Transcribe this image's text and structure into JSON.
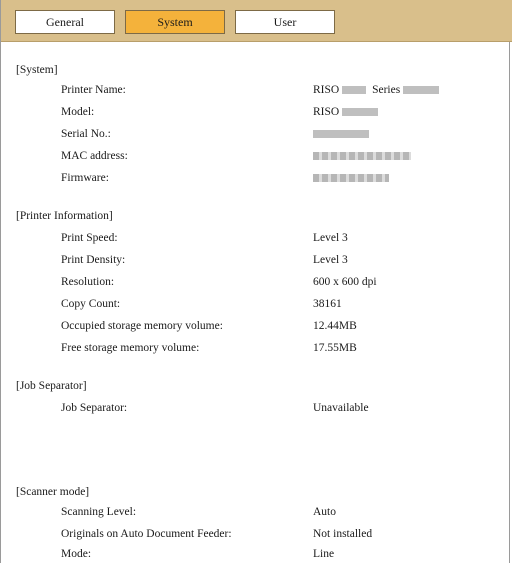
{
  "tabs": [
    {
      "label": "General",
      "active": false
    },
    {
      "label": "System",
      "active": true
    },
    {
      "label": "User",
      "active": false
    }
  ],
  "colors": {
    "tabbar": "#d9bf8b",
    "active_tab": "#f4b23b"
  },
  "sections": {
    "system": {
      "title": "[System]",
      "rows": [
        {
          "label": "Printer Name:",
          "value_prefix": "RISO",
          "value_mid": "Series"
        },
        {
          "label": "Model:",
          "value_prefix": "RISO"
        },
        {
          "label": "Serial No.:"
        },
        {
          "label": "MAC address:"
        },
        {
          "label": "Firmware:"
        }
      ]
    },
    "printer_info": {
      "title": "[Printer Information]",
      "rows": [
        {
          "label": "Print Speed:",
          "value": "Level 3"
        },
        {
          "label": "Print Density:",
          "value": "Level 3"
        },
        {
          "label": "Resolution:",
          "value": "600 x 600 dpi"
        },
        {
          "label": "Copy Count:",
          "value": "38161"
        },
        {
          "label": "Occupied storage memory volume:",
          "value": "12.44MB"
        },
        {
          "label": "Free storage memory volume:",
          "value": "17.55MB"
        }
      ]
    },
    "job_separator": {
      "title": "[Job Separator]",
      "rows": [
        {
          "label": "Job Separator:",
          "value": "Unavailable"
        }
      ]
    },
    "scanner_mode": {
      "title": "[Scanner mode]",
      "rows": [
        {
          "label": "Scanning Level:",
          "value": "Auto"
        },
        {
          "label": "Originals on Auto Document Feeder:",
          "value": "Not installed"
        },
        {
          "label": "Mode:",
          "value": "Line"
        }
      ]
    }
  }
}
